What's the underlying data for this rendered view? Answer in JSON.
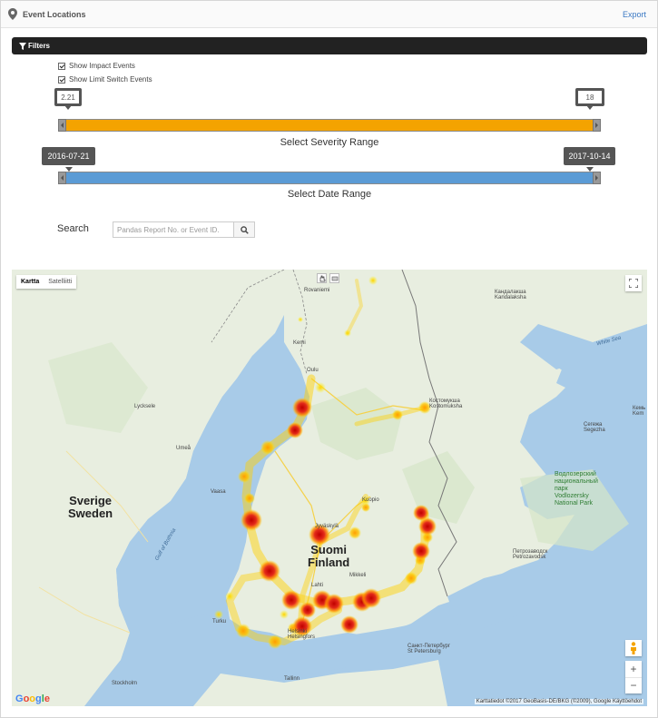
{
  "header": {
    "title": "Event Locations",
    "export_label": "Export"
  },
  "filters": {
    "label": "Filters",
    "show_impact": "Show Impact Events",
    "show_limit": "Show Limit Switch Events",
    "severity": {
      "min": "2.21",
      "max": "18",
      "caption": "Select Severity Range"
    },
    "date": {
      "min": "2016-07-21",
      "max": "2017-10-14",
      "caption": "Select Date Range"
    }
  },
  "search": {
    "label": "Search",
    "placeholder": "Pandas Report No. or Event ID."
  },
  "map": {
    "type_map": "Kartta",
    "type_satellite": "Satelliitti",
    "google": "Google",
    "attribution": "Karttatiedot ©2017 GeoBasis-DE/BKG (©2009), Google   Käyttöehdot",
    "countries": {
      "sweden": "Sverige\nSweden",
      "finland": "Suomi\nFinland"
    },
    "park": "Водлозерский\nнациональный\nпарк\nVodlozersky\nNational Park",
    "sea": "White Sea",
    "gulf": "Gulf of Bothnia",
    "cities": {
      "rovaniemi": "Rovaniemi",
      "oulu": "Oulu",
      "umea": "Umeå",
      "vaasa": "Vaasa",
      "kuopio": "Kuopio",
      "turku": "Turku",
      "helsinki": "Helsinki\nHelsingfors",
      "tallinn": "Tallinn",
      "stockholm": "Stockholm",
      "spb": "Санкт-Петербург\nSt Petersburg",
      "petrozavodsk": "Петрозаводск\nPetrozavodsk",
      "kostomuksha": "Костомукша\nKostomuksha",
      "lycksele": "Lycksele",
      "kemi": "Kemi",
      "segezha": "Сегежа\nSegezha",
      "kandalaksha": "Кандалакша\nKandalaksha",
      "kem": "Кемь\nKem",
      "lahti": "Lahti",
      "mikkeli": "Mikkeli",
      "jyvaskyla": "Jyväskylä"
    }
  },
  "colors": {
    "severity_bar": "#f4a300",
    "date_bar": "#5b9bd5",
    "land": "#e8eee0",
    "water": "#a8cbe8"
  }
}
